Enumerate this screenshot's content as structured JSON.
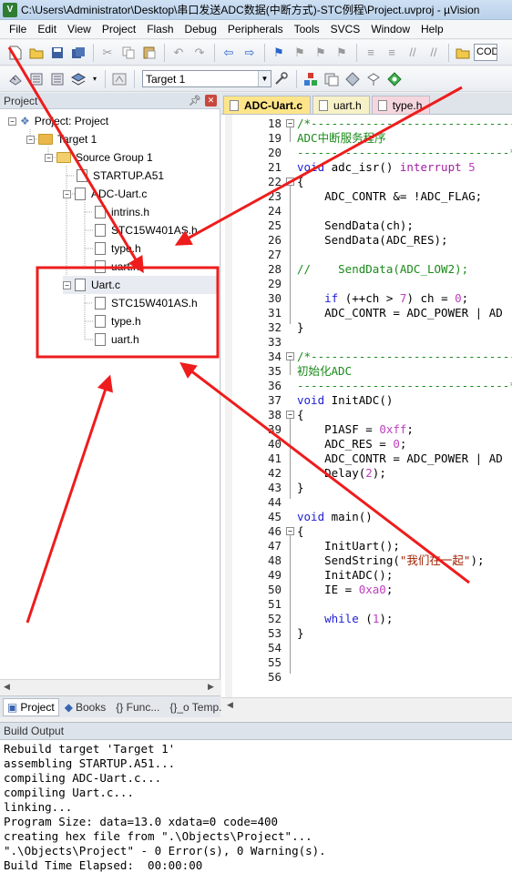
{
  "window": {
    "title": "C:\\Users\\Administrator\\Desktop\\串口发送ADC数据(中断方式)-STC例程\\Project.uvproj - µVision"
  },
  "menu": [
    "File",
    "Edit",
    "View",
    "Project",
    "Flash",
    "Debug",
    "Peripherals",
    "Tools",
    "SVCS",
    "Window",
    "Help"
  ],
  "toolbar": {
    "target": "Target 1",
    "code_box": "COD"
  },
  "project_panel": {
    "title": "Project",
    "tree": [
      {
        "label": "Project: Project",
        "level": 0
      },
      {
        "label": "Target 1",
        "level": 1
      },
      {
        "label": "Source Group 1",
        "level": 2
      },
      {
        "label": "STARTUP.A51",
        "level": 3
      },
      {
        "label": "ADC-Uart.c",
        "level": 3
      },
      {
        "label": "intrins.h",
        "level": 4
      },
      {
        "label": "STC15W401AS.h",
        "level": 4
      },
      {
        "label": "type.h",
        "level": 4
      },
      {
        "label": "uart.h",
        "level": 4
      },
      {
        "label": "Uart.c",
        "level": 3
      },
      {
        "label": "STC15W401AS.h",
        "level": 4
      },
      {
        "label": "type.h",
        "level": 4
      },
      {
        "label": "uart.h",
        "level": 4
      }
    ],
    "tabs": [
      "Project",
      "Books",
      "{} Func...",
      "{}_o Temp..."
    ]
  },
  "editor": {
    "tabs": [
      "ADC-Uart.c",
      "uart.h",
      "type.h"
    ],
    "active_tab": "ADC-Uart.c",
    "lines": [
      {
        "n": "18",
        "text": "/*-------------------------------"
      },
      {
        "n": "19",
        "text": "ADC中断服务程序"
      },
      {
        "n": "20",
        "text": "-------------------------------*/"
      },
      {
        "n": "21",
        "text": "void adc_isr() interrupt 5"
      },
      {
        "n": "22",
        "text": "{"
      },
      {
        "n": "23",
        "text": "    ADC_CONTR &= !ADC_FLAG;"
      },
      {
        "n": "24",
        "text": ""
      },
      {
        "n": "25",
        "text": "    SendData(ch);"
      },
      {
        "n": "26",
        "text": "    SendData(ADC_RES);"
      },
      {
        "n": "27",
        "text": ""
      },
      {
        "n": "28",
        "text": "//    SendData(ADC_LOW2);"
      },
      {
        "n": "29",
        "text": ""
      },
      {
        "n": "30",
        "text": "    if (++ch > 7) ch = 0;"
      },
      {
        "n": "31",
        "text": "    ADC_CONTR = ADC_POWER | AD"
      },
      {
        "n": "32",
        "text": "}"
      },
      {
        "n": "33",
        "text": ""
      },
      {
        "n": "34",
        "text": "/*-------------------------------"
      },
      {
        "n": "35",
        "text": "初始化ADC"
      },
      {
        "n": "36",
        "text": "-------------------------------*/"
      },
      {
        "n": "37",
        "text": "void InitADC()"
      },
      {
        "n": "38",
        "text": "{"
      },
      {
        "n": "39",
        "text": "    P1ASF = 0xff;"
      },
      {
        "n": "40",
        "text": "    ADC_RES = 0;"
      },
      {
        "n": "41",
        "text": "    ADC_CONTR = ADC_POWER | AD"
      },
      {
        "n": "42",
        "text": "    Delay(2);"
      },
      {
        "n": "43",
        "text": "}"
      },
      {
        "n": "44",
        "text": ""
      },
      {
        "n": "45",
        "text": "void main()"
      },
      {
        "n": "46",
        "text": "{"
      },
      {
        "n": "47",
        "text": "    InitUart();"
      },
      {
        "n": "48",
        "text": "    SendString(\"我们在一起\");"
      },
      {
        "n": "49",
        "text": "    InitADC();"
      },
      {
        "n": "50",
        "text": "    IE = 0xa0;"
      },
      {
        "n": "51",
        "text": ""
      },
      {
        "n": "52",
        "text": "    while (1);"
      },
      {
        "n": "53",
        "text": "}"
      },
      {
        "n": "54",
        "text": ""
      },
      {
        "n": "55",
        "text": ""
      },
      {
        "n": "56",
        "text": ""
      }
    ]
  },
  "build_output": {
    "title": "Build Output",
    "lines": [
      "Rebuild target 'Target 1'",
      "assembling STARTUP.A51...",
      "compiling ADC-Uart.c...",
      "compiling Uart.c...",
      "linking...",
      "Program Size: data=13.0 xdata=0 code=400",
      "creating hex file from \".\\Objects\\Project\"...",
      "\".\\Objects\\Project\" - 0 Error(s), 0 Warning(s).",
      "Build Time Elapsed:  00:00:00"
    ]
  },
  "colors": {
    "annotation": "#ee1c1c",
    "active_tab": "#ffe58a",
    "keyword": "#1f1fd6",
    "comment": "#1a8a1a"
  }
}
